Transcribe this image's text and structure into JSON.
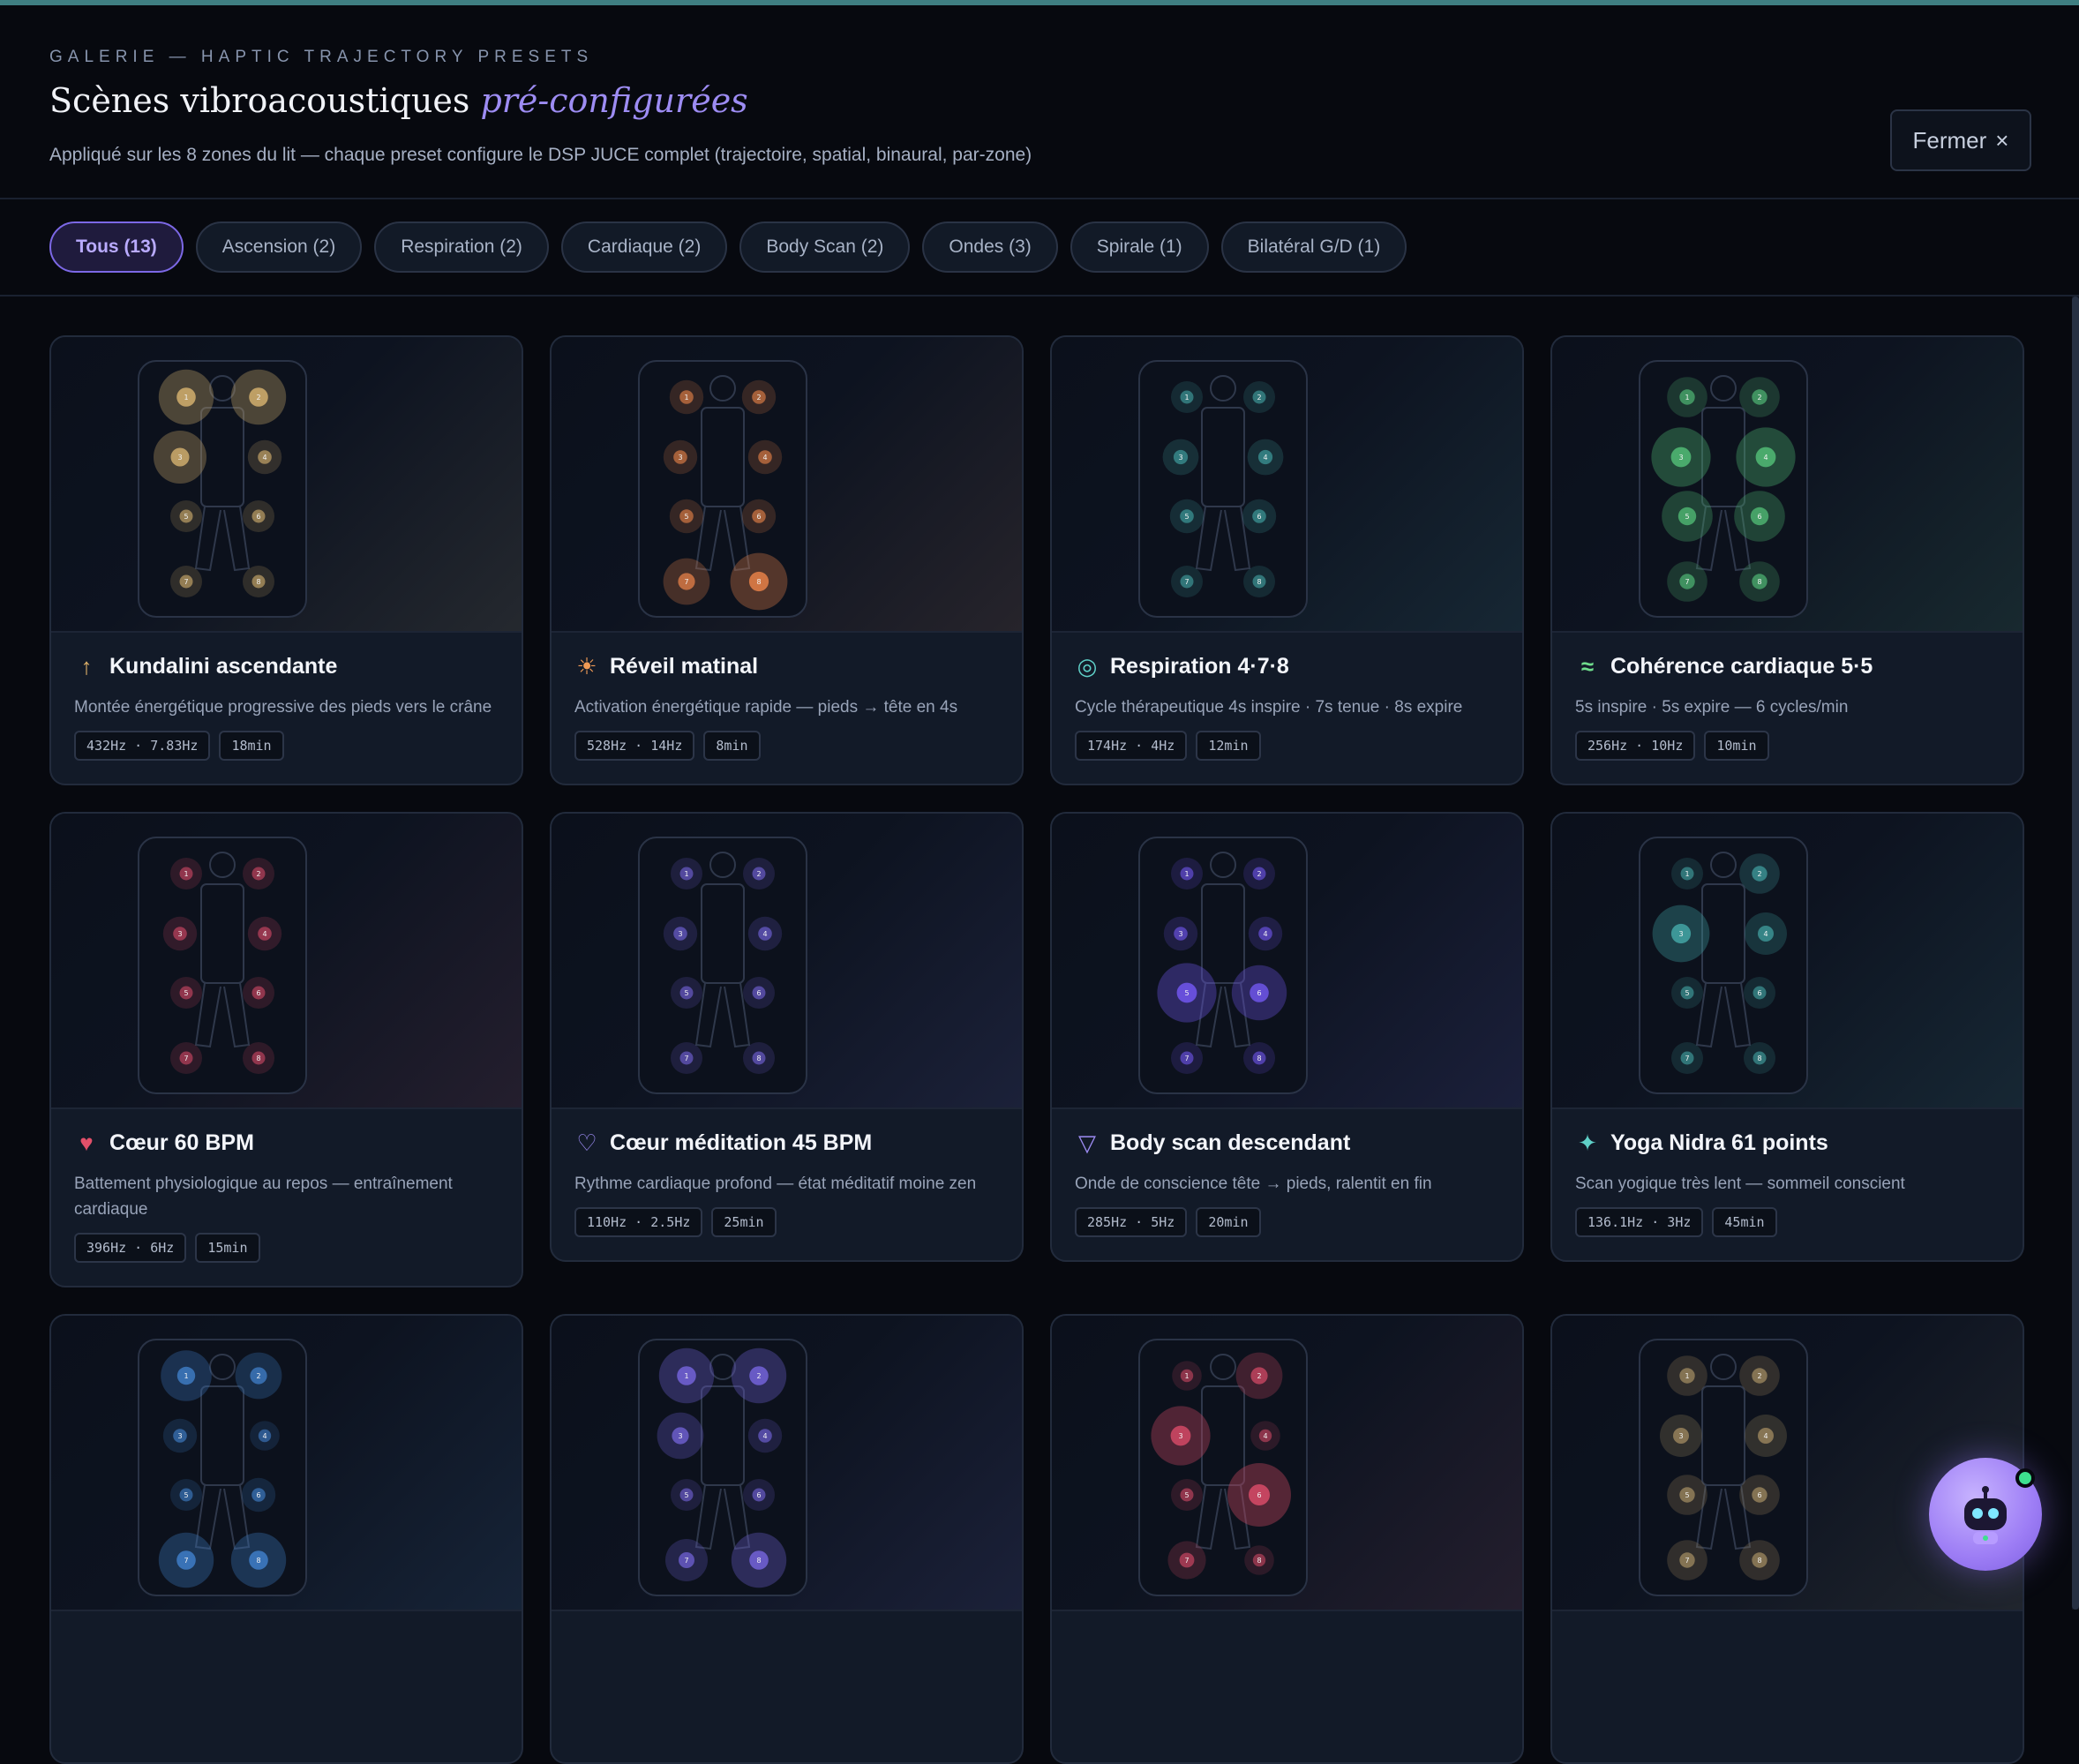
{
  "header": {
    "eyebrow": "GALERIE — HAPTIC TRAJECTORY PRESETS",
    "title_main": "Scènes vibroacoustiques",
    "title_accent": "pré-configurées",
    "subtitle": "Appliqué sur les 8 zones du lit — chaque preset configure le DSP JUCE complet (trajectoire, spatial, binaural, par-zone)",
    "close_label": "Fermer",
    "close_icon": "×"
  },
  "filters": [
    {
      "label": "Tous (13)",
      "active": true
    },
    {
      "label": "Ascension (2)",
      "active": false
    },
    {
      "label": "Respiration (2)",
      "active": false
    },
    {
      "label": "Cardiaque (2)",
      "active": false
    },
    {
      "label": "Body Scan (2)",
      "active": false
    },
    {
      "label": "Ondes (3)",
      "active": false
    },
    {
      "label": "Spirale (1)",
      "active": false
    },
    {
      "label": "Bilatéral G/D (1)",
      "active": false
    }
  ],
  "presets": [
    {
      "icon": "↑",
      "icon_name": "arrow-up-icon",
      "icon_color": "#e0b36a",
      "title": "Kundalini ascendante",
      "desc": "Montée énergétique progressive des pieds vers le crâne",
      "tags": [
        "432Hz · 7.83Hz",
        "18min"
      ],
      "color": "#c9a86a",
      "zones": [
        0.8,
        0.8,
        0.75,
        0.3,
        0.25,
        0.25,
        0.25,
        0.25
      ]
    },
    {
      "icon": "☀",
      "icon_name": "sun-icon",
      "icon_color": "#f09a55",
      "title": "Réveil matinal",
      "desc": "Activation énergétique rapide — pieds → tête en 4s",
      "tags": [
        "528Hz · 14Hz",
        "8min"
      ],
      "color": "#d97a45",
      "zones": [
        0.3,
        0.3,
        0.3,
        0.3,
        0.3,
        0.3,
        0.6,
        0.85
      ]
    },
    {
      "icon": "◎",
      "icon_name": "breath-ring-icon",
      "icon_color": "#5fd0c8",
      "title": "Respiration 4·7·8",
      "desc": "Cycle thérapeutique 4s inspire · 7s tenue · 8s expire",
      "tags": [
        "174Hz · 4Hz",
        "12min"
      ],
      "color": "#3f9c9c",
      "zones": [
        0.25,
        0.25,
        0.35,
        0.35,
        0.3,
        0.3,
        0.25,
        0.25
      ]
    },
    {
      "icon": "≈",
      "icon_name": "wave-icon",
      "icon_color": "#6fdc8c",
      "title": "Cohérence cardiaque 5·5",
      "desc": "5s inspire · 5s expire — 6 cycles/min",
      "tags": [
        "256Hz · 10Hz",
        "10min"
      ],
      "color": "#4caf6f",
      "zones": [
        0.45,
        0.45,
        0.9,
        0.9,
        0.7,
        0.7,
        0.45,
        0.45
      ]
    },
    {
      "icon": "♥",
      "icon_name": "heart-filled-icon",
      "icon_color": "#e2506a",
      "title": "Cœur 60 BPM",
      "desc": "Battement physiologique au repos — entraînement cardiaque",
      "tags": [
        "396Hz · 6Hz",
        "15min"
      ],
      "color": "#c44560",
      "zones": [
        0.25,
        0.25,
        0.3,
        0.3,
        0.25,
        0.25,
        0.25,
        0.25
      ]
    },
    {
      "icon": "♡",
      "icon_name": "heart-outline-icon",
      "icon_color": "#9d8cf3",
      "title": "Cœur méditation 45 BPM",
      "desc": "Rythme cardiaque profond — état méditatif moine zen",
      "tags": [
        "110Hz · 2.5Hz",
        "25min"
      ],
      "color": "#6e5fd0",
      "zones": [
        0.25,
        0.25,
        0.3,
        0.3,
        0.25,
        0.25,
        0.25,
        0.25
      ]
    },
    {
      "icon": "▽",
      "icon_name": "triangle-down-icon",
      "icon_color": "#9d8cf3",
      "title": "Body scan descendant",
      "desc": "Onde de conscience tête → pieds, ralentit en fin",
      "tags": [
        "285Hz · 5Hz",
        "20min"
      ],
      "color": "#6a52e0",
      "zones": [
        0.25,
        0.25,
        0.3,
        0.3,
        0.9,
        0.8,
        0.25,
        0.25
      ]
    },
    {
      "icon": "✦",
      "icon_name": "sparkle-icon",
      "icon_color": "#5fd0c8",
      "title": "Yoga Nidra 61 points",
      "desc": "Scan yogique très lent — sommeil conscient",
      "tags": [
        "136.1Hz · 3Hz",
        "45min"
      ],
      "color": "#3f9c9c",
      "zones": [
        0.25,
        0.45,
        0.85,
        0.5,
        0.25,
        0.25,
        0.25,
        0.25
      ]
    },
    {
      "icon": "",
      "icon_name": "",
      "icon_color": "#4a86c8",
      "title": "",
      "desc": "",
      "tags": [],
      "color": "#3d79c0",
      "zones": [
        0.7,
        0.6,
        0.3,
        0.2,
        0.25,
        0.3,
        0.8,
        0.8
      ]
    },
    {
      "icon": "",
      "icon_name": "",
      "icon_color": "#7d68e6",
      "title": "",
      "desc": "",
      "tags": [],
      "color": "#6e5fd0",
      "zones": [
        0.8,
        0.8,
        0.6,
        0.3,
        0.25,
        0.25,
        0.5,
        0.8
      ]
    },
    {
      "icon": "",
      "icon_name": "",
      "icon_color": "#e2506a",
      "title": "",
      "desc": "",
      "tags": [],
      "color": "#c44560",
      "zones": [
        0.2,
        0.6,
        0.9,
        0.2,
        0.25,
        1.0,
        0.4,
        0.2
      ]
    },
    {
      "icon": "",
      "icon_name": "",
      "icon_color": "#c9a86a",
      "title": "",
      "desc": "",
      "tags": [],
      "color": "#a08a5f",
      "zones": [
        0.45,
        0.45,
        0.5,
        0.5,
        0.45,
        0.45,
        0.45,
        0.45
      ]
    }
  ],
  "assistant": {
    "icon": "robot-icon",
    "status_color": "#3ee08f"
  }
}
